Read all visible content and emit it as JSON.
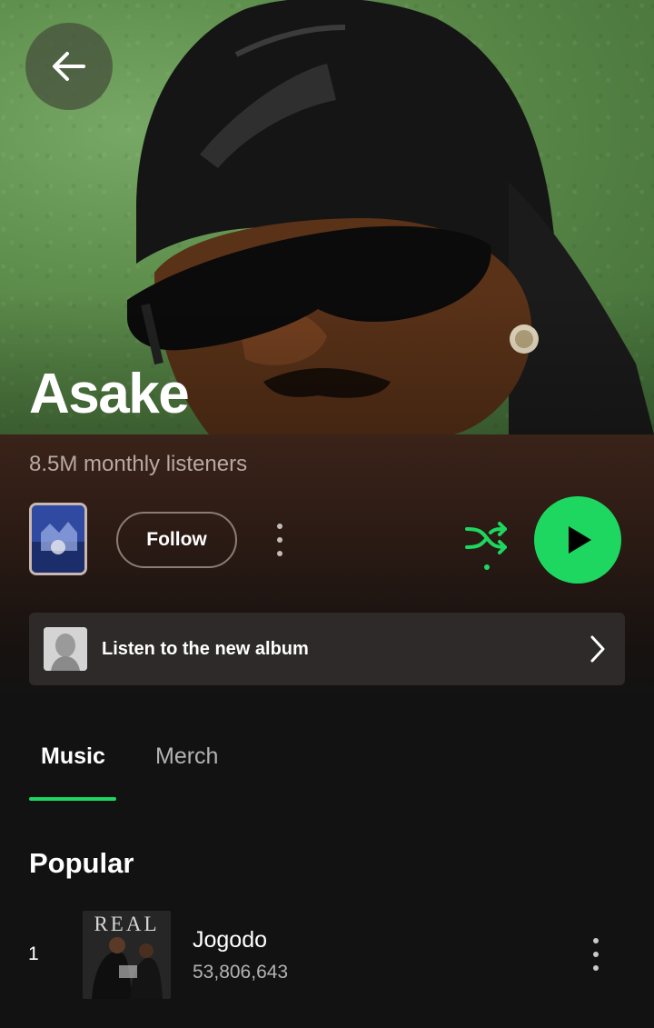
{
  "artist": {
    "name": "Asake",
    "monthly_listeners": "8.5M monthly listeners"
  },
  "actions": {
    "follow_label": "Follow",
    "shuffle_color": "#1ed760",
    "play_color": "#1ed760"
  },
  "promo": {
    "label": "Listen to the new album"
  },
  "tabs": [
    {
      "label": "Music",
      "active": true
    },
    {
      "label": "Merch",
      "active": false
    }
  ],
  "popular": {
    "title": "Popular",
    "tracks": [
      {
        "rank": "1",
        "title": "Jogodo",
        "plays": "53,806,643",
        "art_text": "REAL"
      }
    ]
  },
  "icons": {
    "back": "arrow-left-icon",
    "more": "more-vertical-icon",
    "shuffle": "shuffle-icon",
    "play": "play-icon",
    "chevron": "chevron-right-icon"
  }
}
